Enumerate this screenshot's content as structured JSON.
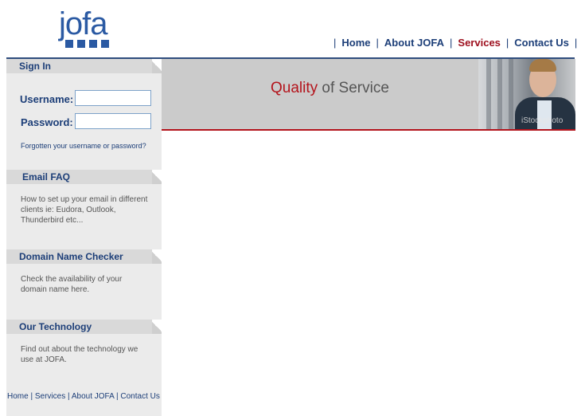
{
  "logo": {
    "text": "jofa"
  },
  "topnav": {
    "items": [
      {
        "label": "Home"
      },
      {
        "label": "About JOFA"
      },
      {
        "label": "Services"
      },
      {
        "label": "Contact Us"
      }
    ],
    "separator": "|",
    "active_color": "#9c0d1c"
  },
  "sidebar": {
    "signin": {
      "title": "Sign In",
      "username_label": "Username:",
      "password_label": "Password:",
      "username_value": "",
      "password_value": "",
      "forgot_link": "Forgotten your username or password?"
    },
    "email_faq": {
      "title": "Email FAQ",
      "desc": "How to set up your email in different clients ie: Eudora, Outlook, Thunderbird etc..."
    },
    "domain_checker": {
      "title": "Domain Name Checker",
      "desc": "Check the availability of your domain name here."
    },
    "technology": {
      "title": "Our Technology",
      "desc": "Find out about the technology we use at JOFA."
    }
  },
  "footer": {
    "links": [
      "Home",
      "Services",
      "About JOFA",
      "Contact Us"
    ],
    "separator": "|"
  },
  "banner": {
    "highlight": "Quality",
    "rest": "of Service",
    "watermark": "iStockphoto"
  },
  "colors": {
    "brand": "#2b5aa3",
    "nav": "#1c3e78",
    "accent_red": "#b4141c"
  }
}
